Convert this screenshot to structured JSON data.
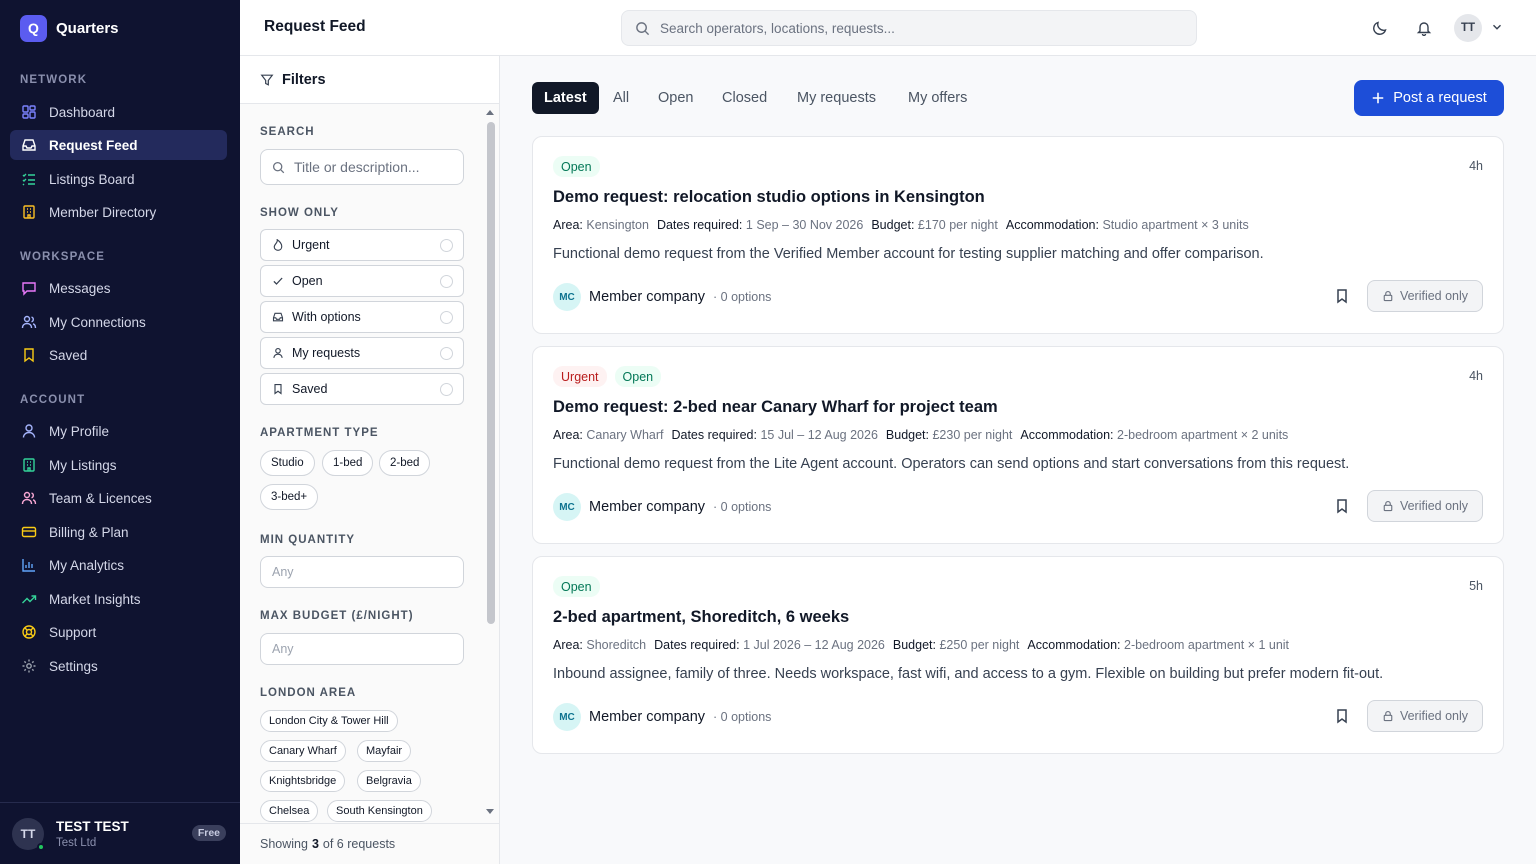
{
  "brand": {
    "logo_letter": "Q",
    "name": "Quarters"
  },
  "sidebar": {
    "sections": [
      {
        "label": "NETWORK",
        "items": [
          {
            "label": "Dashboard",
            "icon": "dashboard-icon"
          },
          {
            "label": "Request Feed",
            "icon": "inbox-icon",
            "active": true
          },
          {
            "label": "Listings Board",
            "icon": "list-check-icon"
          },
          {
            "label": "Member Directory",
            "icon": "building-icon"
          }
        ]
      },
      {
        "label": "WORKSPACE",
        "items": [
          {
            "label": "Messages",
            "icon": "message-icon"
          },
          {
            "label": "My Connections",
            "icon": "users-icon"
          },
          {
            "label": "Saved",
            "icon": "bookmark-icon"
          }
        ]
      },
      {
        "label": "ACCOUNT",
        "items": [
          {
            "label": "My Profile",
            "icon": "user-icon"
          },
          {
            "label": "My Listings",
            "icon": "building-icon"
          },
          {
            "label": "Team & Licences",
            "icon": "users-icon"
          },
          {
            "label": "Billing & Plan",
            "icon": "credit-card-icon"
          },
          {
            "label": "My Analytics",
            "icon": "bar-chart-icon"
          },
          {
            "label": "Market Insights",
            "icon": "trending-up-icon"
          },
          {
            "label": "Support",
            "icon": "lifebuoy-icon"
          },
          {
            "label": "Settings",
            "icon": "gear-icon"
          }
        ]
      }
    ],
    "user": {
      "initials": "TT",
      "name": "TEST TEST",
      "company": "Test Ltd",
      "plan": "Free"
    }
  },
  "header": {
    "title": "Request Feed",
    "search_placeholder": "Search operators, locations, requests...",
    "avatar_initials": "TT"
  },
  "filters": {
    "title": "Filters",
    "search_label": "SEARCH",
    "search_placeholder": "Title or description...",
    "show_only_label": "SHOW ONLY",
    "show_only": [
      {
        "label": "Urgent",
        "icon": "flame-icon"
      },
      {
        "label": "Open",
        "icon": "check-icon"
      },
      {
        "label": "With options",
        "icon": "inbox-icon"
      },
      {
        "label": "My requests",
        "icon": "user-icon"
      },
      {
        "label": "Saved",
        "icon": "bookmark-icon"
      }
    ],
    "apartment_type_label": "APARTMENT TYPE",
    "apartment_types": [
      "Studio",
      "1-bed",
      "2-bed",
      "3-bed+"
    ],
    "min_quantity_label": "MIN QUANTITY",
    "min_quantity_placeholder": "Any",
    "max_budget_label": "MAX BUDGET (£/NIGHT)",
    "max_budget_placeholder": "Any",
    "london_area_label": "LONDON AREA",
    "areas": [
      "London City & Tower Hill",
      "Canary Wharf",
      "Mayfair",
      "Knightsbridge",
      "Belgravia",
      "Chelsea",
      "South Kensington"
    ],
    "footer": {
      "prefix": "Showing",
      "shown": "3",
      "middle": "of 6 requests"
    }
  },
  "tabs": [
    "Latest",
    "All",
    "Open",
    "Closed",
    "My requests",
    "My offers"
  ],
  "post_button": "Post a request",
  "requests": [
    {
      "badges": [
        {
          "label": "Open",
          "type": "open"
        }
      ],
      "time": "4h",
      "title": "Demo request: relocation studio options in Kensington",
      "area_key": "Area:",
      "area": "Kensington",
      "dates_key": "Dates required:",
      "dates": "1 Sep – 30 Nov 2026",
      "budget_key": "Budget:",
      "budget": "£170 per night",
      "accom_key": "Accommodation:",
      "accom": "Studio apartment × 3 units",
      "description": "Functional demo request from the Verified Member account for testing supplier matching and offer comparison.",
      "company_initials": "MC",
      "company": "Member company",
      "options": "· 0 options",
      "action": "Verified only"
    },
    {
      "badges": [
        {
          "label": "Urgent",
          "type": "urgent"
        },
        {
          "label": "Open",
          "type": "open"
        }
      ],
      "time": "4h",
      "title": "Demo request: 2-bed near Canary Wharf for project team",
      "area_key": "Area:",
      "area": "Canary Wharf",
      "dates_key": "Dates required:",
      "dates": "15 Jul – 12 Aug 2026",
      "budget_key": "Budget:",
      "budget": "£230 per night",
      "accom_key": "Accommodation:",
      "accom": "2-bedroom apartment × 2 units",
      "description": "Functional demo request from the Lite Agent account. Operators can send options and start conversations from this request.",
      "company_initials": "MC",
      "company": "Member company",
      "options": "· 0 options",
      "action": "Verified only"
    },
    {
      "badges": [
        {
          "label": "Open",
          "type": "open"
        }
      ],
      "time": "5h",
      "title": "2-bed apartment, Shoreditch, 6 weeks",
      "area_key": "Area:",
      "area": "Shoreditch",
      "dates_key": "Dates required:",
      "dates": "1 Jul 2026 – 12 Aug 2026",
      "budget_key": "Budget:",
      "budget": "£250 per night",
      "accom_key": "Accommodation:",
      "accom": "2-bedroom apartment × 1 unit",
      "description": "Inbound assignee, family of three. Needs workspace, fast wifi, and access to a gym. Flexible on building but prefer modern fit-out.",
      "company_initials": "MC",
      "company": "Member company",
      "options": "· 0 options",
      "action": "Verified only"
    }
  ],
  "colors": {
    "sidebar_bg": "#0f1330",
    "accent": "#1d4ed8",
    "brand": "#5b5cf0",
    "open": "#047857",
    "urgent": "#b91c1c"
  }
}
